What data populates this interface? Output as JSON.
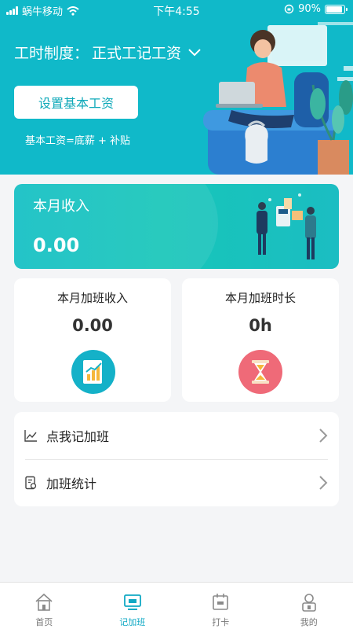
{
  "status_bar": {
    "carrier": "蜗牛移动",
    "time": "下午4:55",
    "battery": "90%",
    "battery_level": 0.9
  },
  "header": {
    "regime_label": "工时制度：",
    "regime_value": "正式工记工资",
    "set_salary_button": "设置基本工资",
    "formula": "基本工资=底薪 + 补贴"
  },
  "income_card": {
    "title": "本月收入",
    "value": "0.00"
  },
  "stats": [
    {
      "title": "本月加班收入",
      "value": "0.00",
      "icon": "chart-document-icon"
    },
    {
      "title": "本月加班时长",
      "value": "0h",
      "icon": "hourglass-icon"
    }
  ],
  "menu": [
    {
      "label": "点我记加班",
      "icon": "line-chart-icon"
    },
    {
      "label": "加班统计",
      "icon": "report-icon"
    }
  ],
  "tabs": [
    {
      "label": "首页",
      "icon": "home-icon",
      "active": false
    },
    {
      "label": "记加班",
      "icon": "monitor-icon",
      "active": true
    },
    {
      "label": "打卡",
      "icon": "calendar-icon",
      "active": false
    },
    {
      "label": "我的",
      "icon": "user-icon",
      "active": false
    }
  ],
  "colors": {
    "accent": "#10b9c9",
    "tab_active": "#11a9c4",
    "hourglass_bg": "#ef6a78"
  }
}
